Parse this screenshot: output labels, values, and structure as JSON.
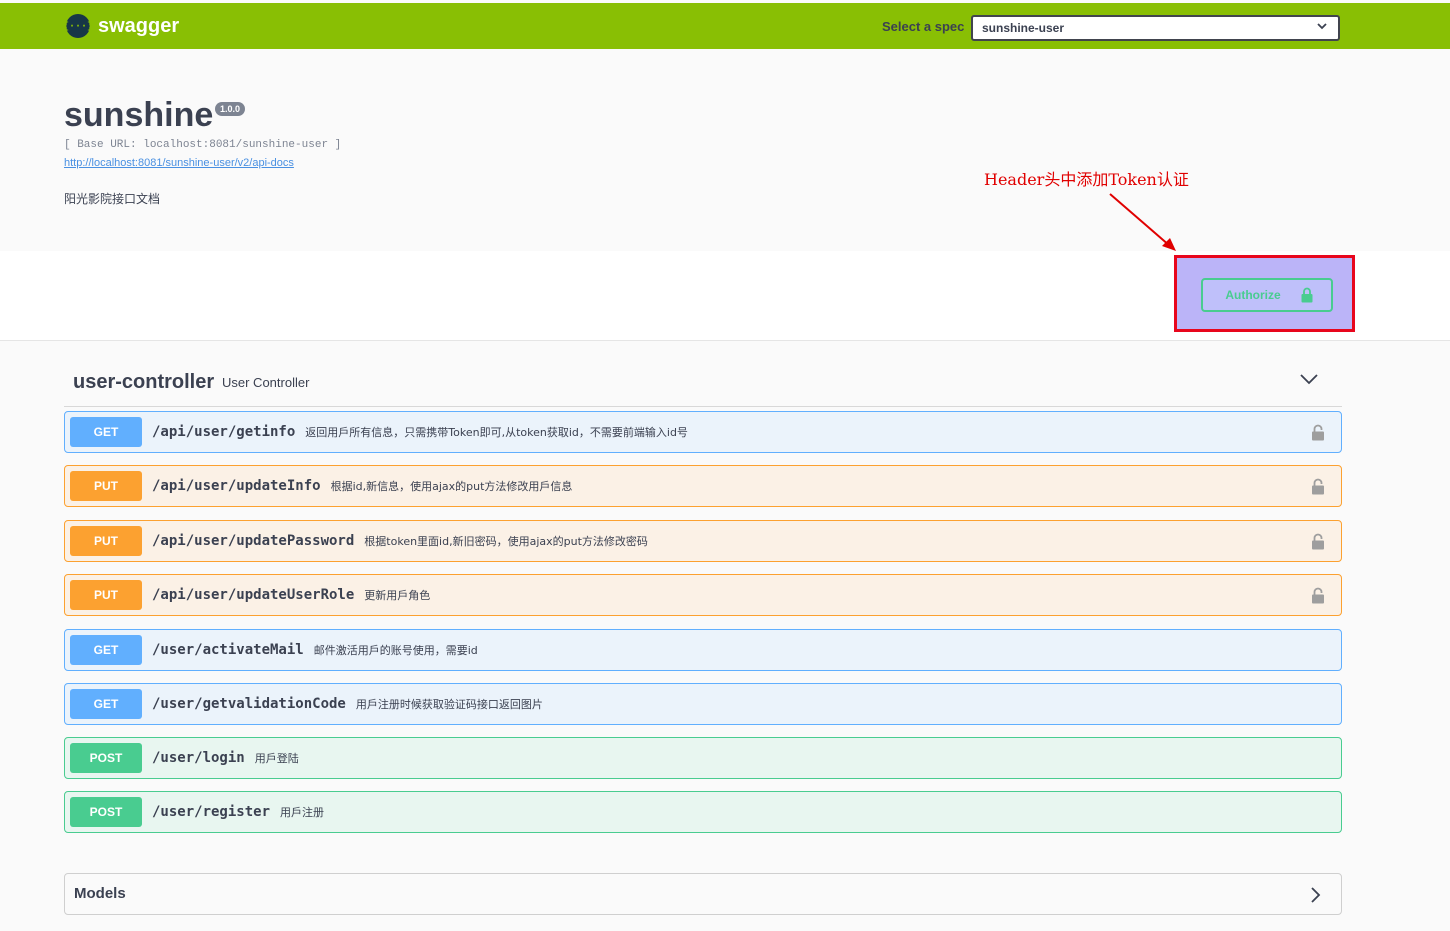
{
  "topbar": {
    "brand": "swagger",
    "logo_glyph": "{···}",
    "spec_label": "Select a spec",
    "spec_value": "sunshine-user"
  },
  "info": {
    "title": "sunshine",
    "version": "1.0.0",
    "base_url": "[ Base URL: localhost:8081/sunshine-user ]",
    "docs_link": "http://localhost:8081/sunshine-user/v2/api-docs",
    "description": "阳光影院接口文档"
  },
  "annotation": {
    "text": "Header头中添加Token认证",
    "color": "#e00000"
  },
  "authorize": {
    "label": "Authorize",
    "icon": "lock-icon"
  },
  "section": {
    "name": "user-controller",
    "description": "User Controller"
  },
  "operations": [
    {
      "method": "GET",
      "path": "/api/user/getinfo",
      "summary": "返回用戶所有信息，只需携带Token即可,从token获取id，不需要前端输入id号",
      "locked": true
    },
    {
      "method": "PUT",
      "path": "/api/user/updateInfo",
      "summary": "根据id,新信息，使用ajax的put方法修改用戶信息",
      "locked": true
    },
    {
      "method": "PUT",
      "path": "/api/user/updatePassword",
      "summary": "根据token里面id,新旧密码，使用ajax的put方法修改密码",
      "locked": true
    },
    {
      "method": "PUT",
      "path": "/api/user/updateUserRole",
      "summary": "更新用戶角色",
      "locked": true
    },
    {
      "method": "GET",
      "path": "/user/activateMail",
      "summary": "邮件激活用戶的账号使用，需要id",
      "locked": false
    },
    {
      "method": "GET",
      "path": "/user/getvalidationCode",
      "summary": "用戶注册时候获取验证码接口返回图片",
      "locked": false
    },
    {
      "method": "POST",
      "path": "/user/login",
      "summary": "用戶登陆",
      "locked": false
    },
    {
      "method": "POST",
      "path": "/user/register",
      "summary": "用戶注册",
      "locked": false
    }
  ],
  "models": {
    "label": "Models"
  },
  "colors": {
    "topbar": "#89bf04",
    "get": "#61affe",
    "put": "#fca130",
    "post": "#49cc90",
    "highlight_border": "#e8061d"
  }
}
